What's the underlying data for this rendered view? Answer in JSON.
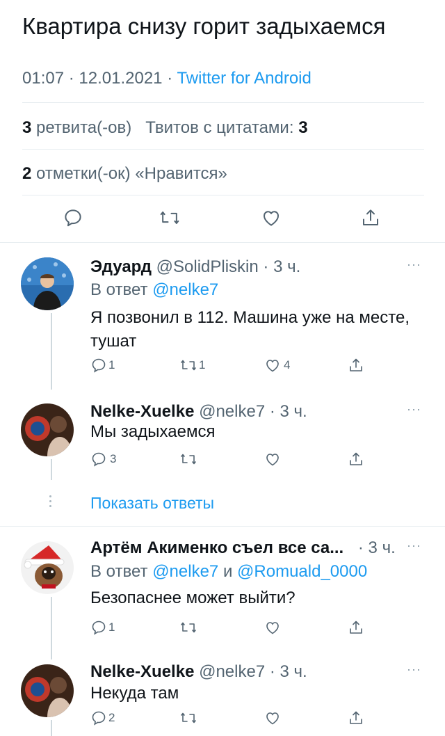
{
  "main_tweet": {
    "text": "Квартира снизу горит задыхаемся",
    "time": "01:07",
    "date": "12.01.2021",
    "sep": "·",
    "source": "Twitter for Android",
    "retweets_count": "3",
    "retweets_label": "ретвита(-ов)",
    "quotes_label": "Твитов с цитатами:",
    "quotes_count": "3",
    "likes_count": "2",
    "likes_label": "отметки(-ок) «Нравится»"
  },
  "replies": [
    {
      "name": "Эдуард",
      "handle": "@SolidPliskin",
      "time": "· 3 ч.",
      "reply_prefix": "В ответ",
      "reply_to": "@nelke7",
      "text": "Я позвонил в 112. Машина уже на месте, тушат",
      "reply_count": "1",
      "retweet_count": "1",
      "like_count": "4"
    },
    {
      "name": "Nelke-Xuelke",
      "handle": "@nelke7",
      "time": "· 3 ч.",
      "text": "Мы задыхаемся",
      "reply_count": "3"
    },
    {
      "name": "Артём Акименко съел все са...",
      "handle": "",
      "time": "· 3 ч.",
      "reply_prefix": "В ответ",
      "reply_to": "@nelke7",
      "reply_and": "и",
      "reply_to2": "@Romuald_0000",
      "text": "Безопаснее может выйти?",
      "reply_count": "1"
    },
    {
      "name": "Nelke-Xuelke",
      "handle": "@nelke7",
      "time": "· 3 ч.",
      "text": "Некуда там",
      "reply_count": "2"
    }
  ],
  "show_replies_label": "Показать ответы",
  "more_glyph": "···",
  "icons": [
    "reply-icon",
    "retweet-icon",
    "like-icon",
    "share-icon",
    "more-icon"
  ],
  "colors": {
    "accent": "#1d9bf0",
    "secondary_text": "#536471",
    "divider": "#e6ecf0"
  }
}
